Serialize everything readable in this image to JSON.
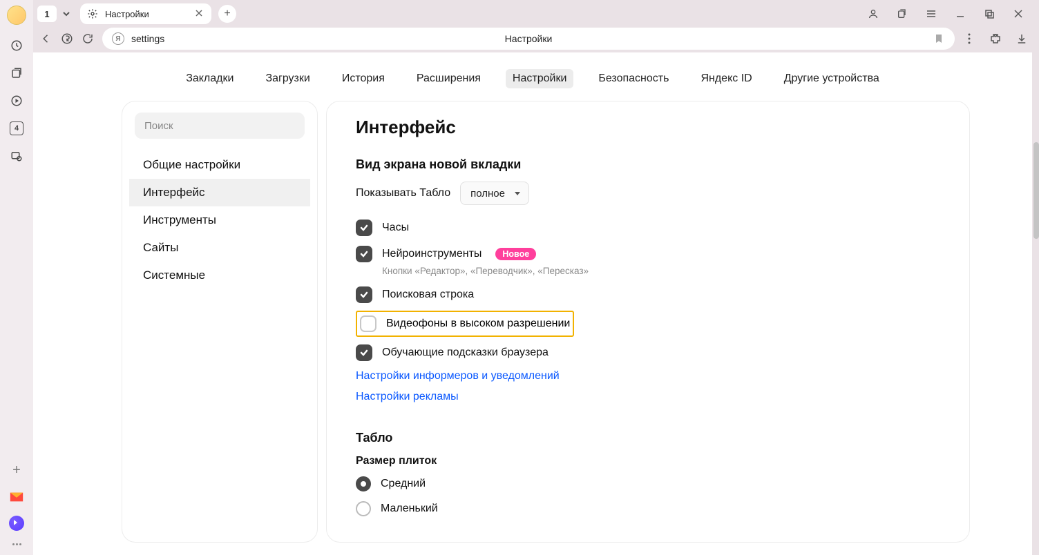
{
  "tabstrip": {
    "counter": "1",
    "tab_title": "Настройки"
  },
  "toolbar": {
    "url": "settings",
    "site_badge": "Я",
    "title": "Настройки"
  },
  "topnav": {
    "items": [
      "Закладки",
      "Загрузки",
      "История",
      "Расширения",
      "Настройки",
      "Безопасность",
      "Яндекс ID",
      "Другие устройства"
    ],
    "active_index": 4
  },
  "sidebar": {
    "search_placeholder": "Поиск",
    "items": [
      "Общие настройки",
      "Интерфейс",
      "Инструменты",
      "Сайты",
      "Системные"
    ],
    "selected_index": 1
  },
  "main": {
    "heading": "Интерфейс",
    "section1_title": "Вид экрана новой вкладки",
    "tablo_label": "Показывать Табло",
    "tablo_value": "полное",
    "check_clock": "Часы",
    "check_neuro": "Нейроинструменты",
    "neuro_badge": "Новое",
    "neuro_sub": "Кнопки «Редактор», «Переводчик», «Пересказ»",
    "check_search": "Поисковая строка",
    "check_video": "Видеофоны в высоком разрешении",
    "check_tips": "Обучающие подсказки браузера",
    "link_informers": "Настройки информеров и уведомлений",
    "link_ads": "Настройки рекламы",
    "section2_title": "Табло",
    "tile_size_label": "Размер плиток",
    "radio_medium": "Средний",
    "radio_small": "Маленький"
  },
  "left_rail_num": "4"
}
